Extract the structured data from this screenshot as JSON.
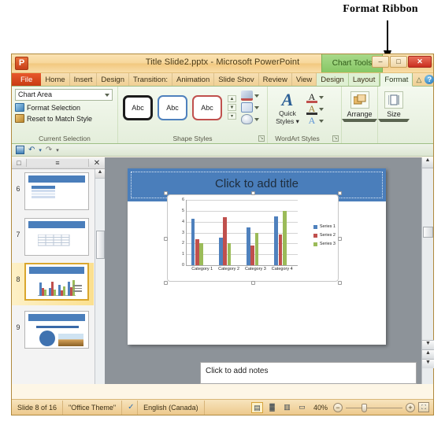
{
  "annotation": {
    "label": "Format Ribbon",
    "arrow_icon": "down-arrow-icon"
  },
  "window": {
    "app_icon": "powerpoint-logo-icon",
    "app_icon_letter": "P",
    "title": "Title Slide2.pptx  -  Microsoft PowerPoint",
    "contextual_tab_group": "Chart Tools",
    "controls": {
      "minimize": "–",
      "restore": "□",
      "close": "✕"
    }
  },
  "tabs": [
    {
      "label": "File",
      "type": "file"
    },
    {
      "label": "Home",
      "type": "normal"
    },
    {
      "label": "Insert",
      "type": "normal"
    },
    {
      "label": "Design",
      "type": "normal"
    },
    {
      "label": "Transition:",
      "type": "normal"
    },
    {
      "label": "Animation",
      "type": "normal"
    },
    {
      "label": "Slide Shov",
      "type": "normal"
    },
    {
      "label": "Review",
      "type": "normal"
    },
    {
      "label": "View",
      "type": "normal"
    },
    {
      "label": "Design",
      "type": "chart-tools"
    },
    {
      "label": "Layout",
      "type": "chart-tools"
    },
    {
      "label": "Format",
      "type": "active"
    }
  ],
  "tab_right_icons": {
    "minimize_ribbon": "chevron-up-icon",
    "help": "help-icon",
    "help_glyph": "?"
  },
  "ribbon": {
    "current_selection": {
      "group_label": "Current Selection",
      "combo_value": "Chart Area",
      "combo_arrow": "chevron-down-icon",
      "items": [
        {
          "label": "Format Selection",
          "icon": "format-selection-icon"
        },
        {
          "label": "Reset to Match Style",
          "icon": "reset-style-icon"
        }
      ]
    },
    "shape_styles": {
      "group_label": "Shape Styles",
      "gallery": [
        {
          "label": "Abc",
          "style": "black-outline"
        },
        {
          "label": "Abc",
          "style": "blue-outline"
        },
        {
          "label": "Abc",
          "style": "red-outline"
        }
      ],
      "scroll": {
        "up": "▲",
        "down": "▼",
        "more": "▾"
      },
      "effects": [
        {
          "label": "Shape Fill",
          "icon": "shape-fill-icon"
        },
        {
          "label": "Shape Outline",
          "icon": "shape-outline-icon"
        },
        {
          "label": "Shape Effects",
          "icon": "shape-effects-icon"
        }
      ],
      "dialog_launcher": "↘"
    },
    "wordart_styles": {
      "group_label": "WordArt Styles",
      "quick_styles_label_1": "Quick",
      "quick_styles_label_2": "Styles ▾",
      "quick_styles_glyph": "A",
      "effects": [
        {
          "label": "Text Fill",
          "glyph": "A",
          "icon": "text-fill-icon"
        },
        {
          "label": "Text Outline",
          "glyph": "A",
          "icon": "text-outline-icon"
        },
        {
          "label": "Text Effects",
          "glyph": "A",
          "icon": "text-effects-icon"
        }
      ],
      "dialog_launcher": "↘"
    },
    "arrange": {
      "label": "Arrange",
      "icon": "arrange-icon",
      "caret": "▾"
    },
    "size": {
      "label": "Size",
      "icon": "size-icon",
      "caret": "▾"
    }
  },
  "quick_access": {
    "save": "save-icon",
    "undo": "↶",
    "undo_caret": "▾",
    "redo": "↷",
    "customize": "▾"
  },
  "slide_panel": {
    "header": {
      "collapse": "□",
      "outline_tab": "≡",
      "close": "✕"
    },
    "thumbnails": [
      {
        "number": "6",
        "kind": "table",
        "selected": false
      },
      {
        "number": "7",
        "kind": "table",
        "selected": false
      },
      {
        "number": "8",
        "kind": "chart",
        "selected": true
      },
      {
        "number": "9",
        "kind": "diagram",
        "selected": false
      }
    ],
    "scroll": {
      "up": "▲",
      "down": "▼"
    }
  },
  "slide": {
    "title_placeholder": "Click to add title"
  },
  "notes": {
    "placeholder": "Click to add notes"
  },
  "scrollbars": {
    "up": "▲",
    "down": "▼",
    "prev_slide": "▲",
    "next_slide": "▼",
    "back_to_first": "●"
  },
  "status_bar": {
    "slide_count": "Slide 8 of 16",
    "theme": "\"Office Theme\"",
    "spellcheck_icon": "spellcheck-icon",
    "language": "English (Canada)",
    "views": [
      {
        "name": "normal-view",
        "glyph": "▤",
        "active": true
      },
      {
        "name": "slide-sorter-view",
        "glyph": "▓",
        "active": false
      },
      {
        "name": "reading-view",
        "glyph": "▥",
        "active": false
      },
      {
        "name": "slide-show-view",
        "glyph": "▭",
        "active": false
      }
    ],
    "zoom_level": "40%",
    "zoom_out": "−",
    "zoom_in": "+",
    "fit_to_window": "⛶"
  },
  "colors": {
    "series1": "#4f81bd",
    "series2": "#c0504d",
    "series3": "#9bbb59",
    "slide_title_band": "#4a7ebb",
    "file_tab": "#d2461a",
    "chart_tools": "#92c96f"
  },
  "chart_data": {
    "type": "bar",
    "title": "",
    "xlabel": "",
    "ylabel": "",
    "categories": [
      "Category 1",
      "Category 2",
      "Category 3",
      "Category 4"
    ],
    "series": [
      {
        "name": "Series 1",
        "color": "#4f81bd",
        "values": [
          4.3,
          2.5,
          3.5,
          4.5
        ]
      },
      {
        "name": "Series 2",
        "color": "#c0504d",
        "values": [
          2.4,
          4.4,
          1.8,
          2.8
        ]
      },
      {
        "name": "Series 3",
        "color": "#9bbb59",
        "values": [
          2.0,
          2.0,
          3.0,
          5.0
        ]
      }
    ],
    "ylim": [
      0,
      6
    ],
    "yticks": [
      "0",
      "1",
      "2",
      "3",
      "4",
      "5",
      "6"
    ],
    "grid": true,
    "legend": "right"
  }
}
